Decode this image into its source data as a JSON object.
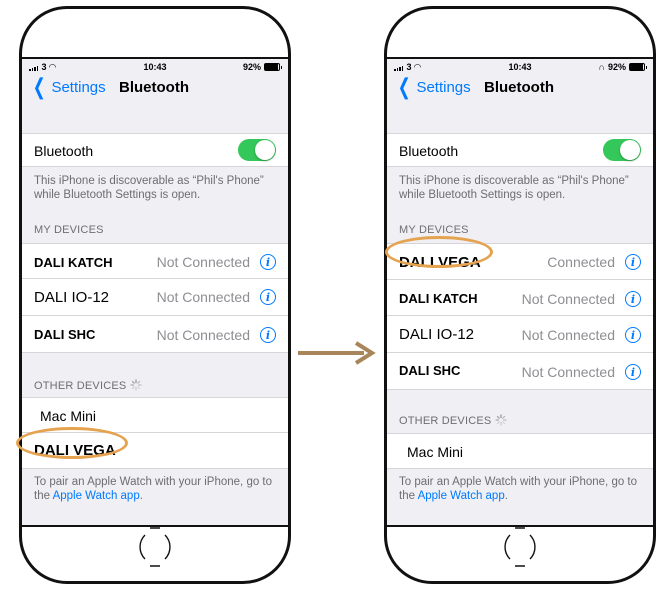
{
  "status": {
    "carrier": "3",
    "time": "10:43",
    "battery_left": "92%",
    "battery_right": "92%",
    "battery_level": 0.92
  },
  "nav": {
    "back_label": "Settings",
    "title": "Bluetooth"
  },
  "bluetooth_label": "Bluetooth",
  "bluetooth_on": true,
  "discoverable_text": "This iPhone is discoverable as “Phil's Phone” while Bluetooth Settings is open.",
  "my_devices_header": "MY DEVICES",
  "other_devices_header": "OTHER DEVICES",
  "left": {
    "my_devices": [
      {
        "name": "DALI KATCH",
        "status": "Not Connected"
      },
      {
        "name": "DALI IO-12",
        "status": "Not Connected"
      },
      {
        "name": "DALI SHC",
        "status": "Not Connected"
      }
    ],
    "other_devices": [
      "Mac  Mini",
      "DALI VEGA"
    ]
  },
  "right": {
    "my_devices": [
      {
        "name": "DALI VEGA",
        "status": "Connected"
      },
      {
        "name": "DALI KATCH",
        "status": "Not Connected"
      },
      {
        "name": "DALI IO-12",
        "status": "Not Connected"
      },
      {
        "name": "DALI SHC",
        "status": "Not Connected"
      }
    ],
    "other_devices": [
      "Mac  Mini"
    ]
  },
  "watch_text": "To pair an Apple Watch with your iPhone, go to the ",
  "watch_link": "Apple Watch app",
  "watch_end": ".",
  "colors": {
    "accent": "#007aff",
    "toggle": "#34c759",
    "highlight": "#e5a24f",
    "arrow": "#a8865a"
  }
}
